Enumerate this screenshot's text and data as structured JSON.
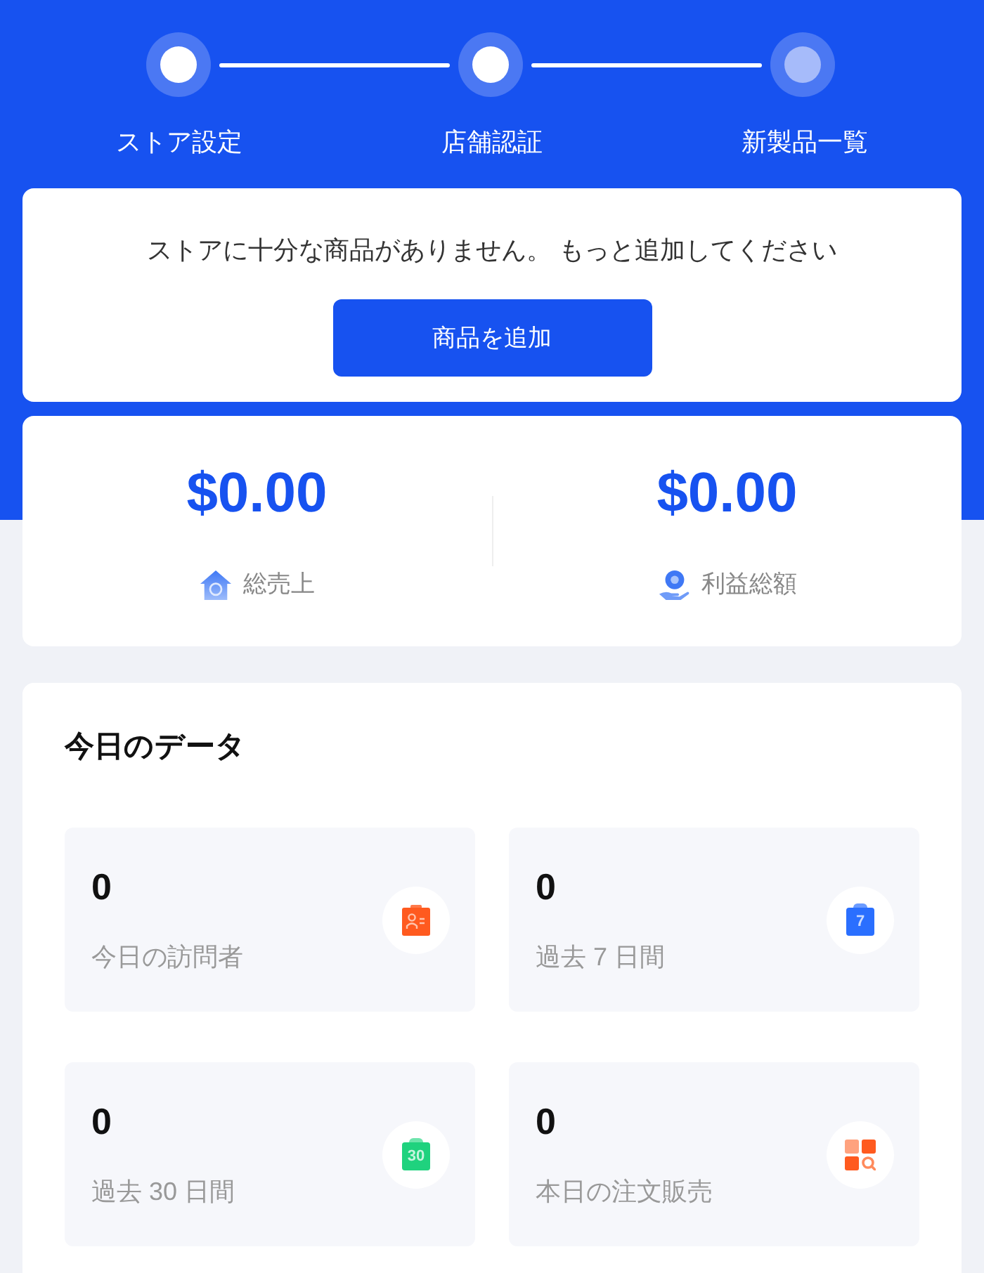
{
  "steps": [
    {
      "label": "ストア設定",
      "done": true
    },
    {
      "label": "店舗認証",
      "done": true
    },
    {
      "label": "新製品一覧",
      "done": false
    }
  ],
  "notice": {
    "message": "ストアに十分な商品がありません。 もっと追加してください",
    "button": "商品を追加"
  },
  "totals": [
    {
      "kind": "sales",
      "amount": "$0.00",
      "label": "総売上"
    },
    {
      "kind": "profit",
      "amount": "$0.00",
      "label": "利益総額"
    }
  ],
  "today": {
    "title": "今日のデータ",
    "stats": [
      {
        "kind": "visitors",
        "value": "0",
        "label": "今日の訪問者"
      },
      {
        "kind": "week",
        "value": "0",
        "label": "過去 7 日間",
        "icon_text": "7"
      },
      {
        "kind": "month",
        "value": "0",
        "label": "過去 30 日間",
        "icon_text": "30"
      },
      {
        "kind": "orders",
        "value": "0",
        "label": "本日の注文販売"
      }
    ]
  }
}
